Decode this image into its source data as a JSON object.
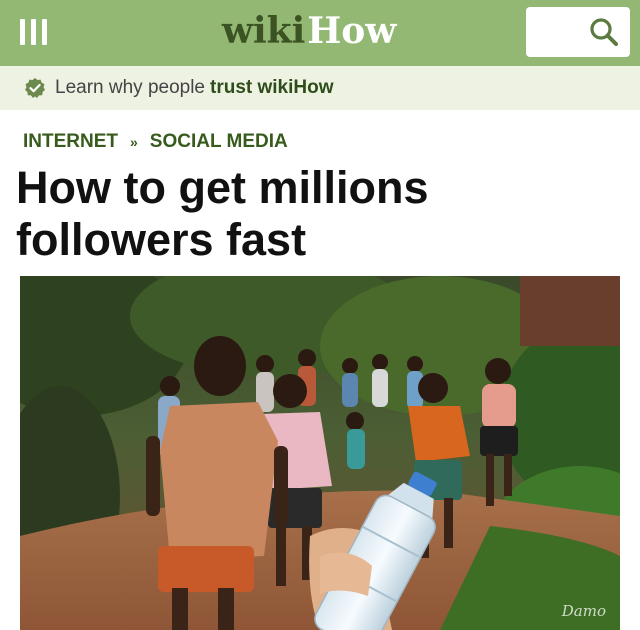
{
  "header": {
    "logo_wiki": "wiki",
    "logo_how": "How",
    "menu_icon": "hamburger-menu-icon",
    "search_icon": "search-icon",
    "brand_color": "#93b874"
  },
  "trust_bar": {
    "text": "Learn why people",
    "link": "trust wikiHow",
    "icon": "checkmark-badge-icon"
  },
  "breadcrumb": {
    "items": [
      "INTERNET",
      "SOCIAL MEDIA"
    ],
    "separator": "»"
  },
  "article": {
    "title": "How to get millions followers fast"
  },
  "image": {
    "watermark": "Damo"
  }
}
